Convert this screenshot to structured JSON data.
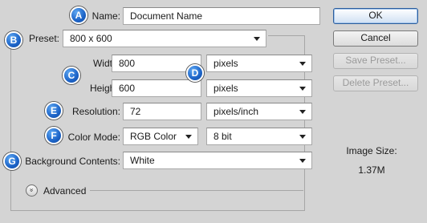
{
  "badges": [
    "A",
    "B",
    "C",
    "D",
    "E",
    "F",
    "G"
  ],
  "name": {
    "label": "Name:",
    "value": "Document Name"
  },
  "preset": {
    "label": "Preset:",
    "value": "800 x 600"
  },
  "width": {
    "label": "Width:",
    "value": "800",
    "unit": "pixels"
  },
  "height": {
    "label": "Height:",
    "value": "600",
    "unit": "pixels"
  },
  "resolution": {
    "label": "Resolution:",
    "value": "72",
    "unit": "pixels/inch"
  },
  "color_mode": {
    "label": "Color Mode:",
    "value": "RGB Color",
    "depth": "8 bit"
  },
  "background": {
    "label": "Background Contents:",
    "value": "White"
  },
  "advanced": {
    "label": "Advanced",
    "toggle_glyph": "»"
  },
  "buttons": {
    "ok": "OK",
    "cancel": "Cancel",
    "save_preset": "Save Preset...",
    "delete_preset": "Delete Preset..."
  },
  "image_size": {
    "label": "Image Size:",
    "value": "1.37M"
  }
}
